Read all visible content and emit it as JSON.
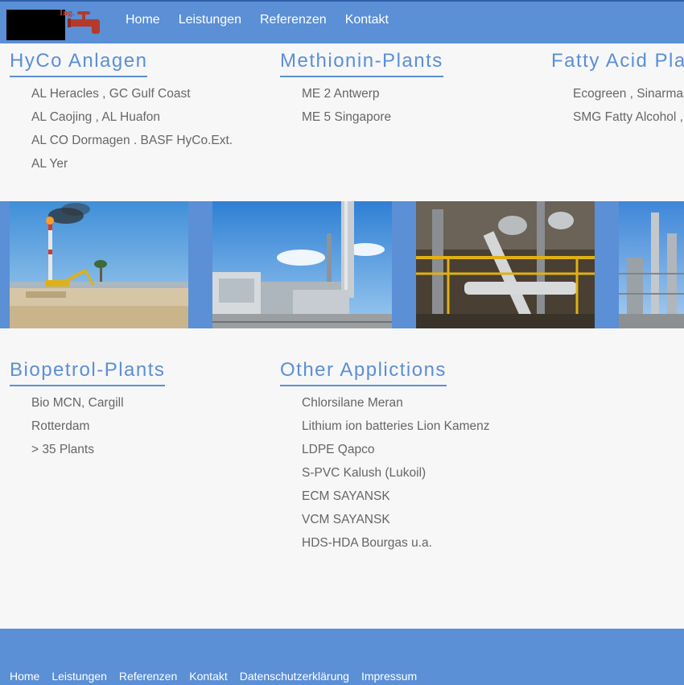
{
  "header": {
    "logo_text": "Ing.",
    "nav": [
      "Home",
      "Leistungen",
      "Referenzen",
      "Kontakt"
    ]
  },
  "sections_top": [
    {
      "title": "HyCo Anlagen",
      "items": [
        "AL Heracles , GC Gulf Coast",
        "AL Caojing , AL Huafon",
        "AL CO Dormagen . BASF HyCo.Ext.",
        "AL Yer"
      ]
    },
    {
      "title": "Methionin-Plants",
      "items": [
        "ME 2 Antwerp",
        "ME 5 Singapore"
      ]
    },
    {
      "title": "Fatty Acid Pla",
      "items": [
        "Ecogreen , Sinarmas",
        "SMG Fatty Alcohol ,"
      ]
    }
  ],
  "sections_bottom": [
    {
      "title": "Biopetrol-Plants",
      "items": [
        "Bio MCN, Cargill",
        "Rotterdam",
        "> 35 Plants"
      ]
    },
    {
      "title": "Other Applictions",
      "items": [
        "Chlorsilane Meran",
        "Lithium ion batteries Lion Kamenz",
        "LDPE Qapco",
        "S-PVC Kalush (Lukoil)",
        "ECM SAYANSK",
        "VCM SAYANSK",
        "HDS-HDA Bourgas u.a."
      ]
    }
  ],
  "footer": {
    "nav": [
      "Home",
      "Leistungen",
      "Referenzen",
      "Kontakt",
      "Datenschutzerklärung",
      "Impressum"
    ]
  },
  "colors": {
    "brand": "#5b8fd6",
    "text": "#666666",
    "logo_red": "#b53a2a"
  }
}
